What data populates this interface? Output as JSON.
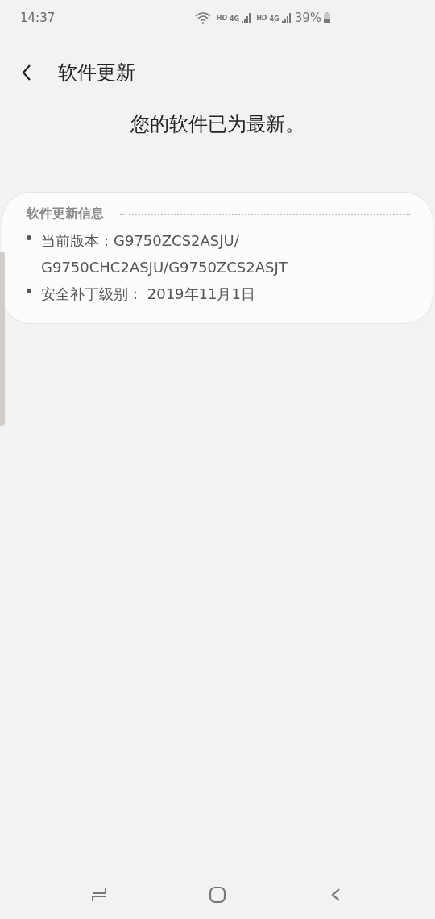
{
  "status_bar": {
    "time": "14:37",
    "networks": [
      {
        "hd": "HD",
        "gen": "4G"
      },
      {
        "hd": "HD",
        "gen": "4G"
      }
    ],
    "battery": "39%"
  },
  "header": {
    "title": "软件更新"
  },
  "message": "您的软件已为最新。",
  "info_card": {
    "title": "软件更新信息",
    "items": [
      {
        "lines": [
          "当前版本：G9750ZCS2ASJU/",
          "G9750CHC2ASJU/G9750ZCS2ASJT"
        ]
      },
      {
        "lines": [
          "安全补丁级别： 2019年11月1日"
        ]
      }
    ]
  }
}
